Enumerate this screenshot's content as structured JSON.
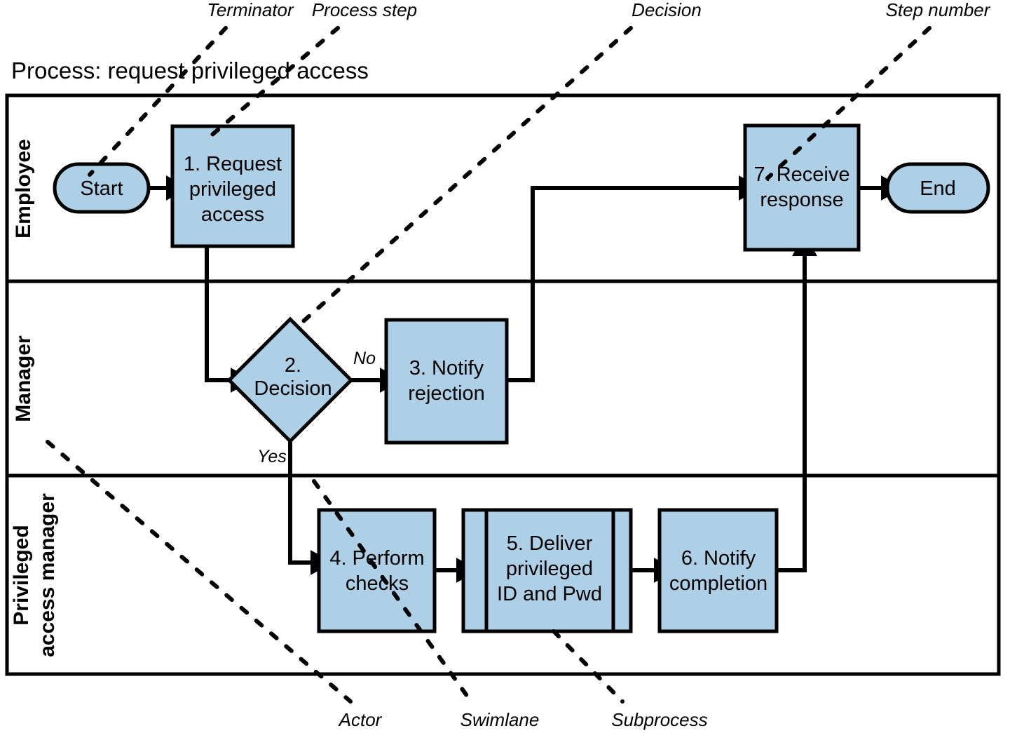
{
  "diagram": {
    "title": "Process: request privileged access",
    "accent_color": "#aed0e6",
    "line_color": "#000000",
    "background": "#ffffff"
  },
  "lanes": [
    {
      "id": "employee",
      "label": "Employee"
    },
    {
      "id": "manager",
      "label": "Manager"
    },
    {
      "id": "privileged-access-manager",
      "label": "Privileged\naccess manager",
      "label_line1": "Privileged",
      "label_line2": "access manager"
    }
  ],
  "nodes": [
    {
      "id": "start",
      "type": "terminator",
      "lane": "employee",
      "label": "Start",
      "lines": [
        "Start"
      ]
    },
    {
      "id": "step1",
      "type": "process",
      "lane": "employee",
      "label": "1. Request privileged access",
      "number": "1",
      "lines": [
        "1. Request",
        "privileged",
        "access"
      ]
    },
    {
      "id": "step7",
      "type": "process",
      "lane": "employee",
      "label": "7. Receive response",
      "number": "7",
      "lines": [
        "7. Receive",
        "response"
      ]
    },
    {
      "id": "end",
      "type": "terminator",
      "lane": "employee",
      "label": "End",
      "lines": [
        "End"
      ]
    },
    {
      "id": "step2",
      "type": "decision",
      "lane": "manager",
      "label": "2. Decision",
      "number": "2",
      "lines": [
        "2.",
        "Decision"
      ]
    },
    {
      "id": "step3",
      "type": "process",
      "lane": "manager",
      "label": "3. Notify rejection",
      "number": "3",
      "lines": [
        "3. Notify",
        "rejection"
      ]
    },
    {
      "id": "step4",
      "type": "process",
      "lane": "privileged-access-manager",
      "label": "4. Perform checks",
      "number": "4",
      "lines": [
        "4. Perform",
        "checks"
      ]
    },
    {
      "id": "step5",
      "type": "subprocess",
      "lane": "privileged-access-manager",
      "label": "5. Deliver privileged ID and Pwd",
      "number": "5",
      "lines": [
        "5. Deliver",
        "privileged",
        "ID and Pwd"
      ]
    },
    {
      "id": "step6",
      "type": "process",
      "lane": "privileged-access-manager",
      "label": "6. Notify completion",
      "number": "6",
      "lines": [
        "6. Notify",
        "completion"
      ]
    }
  ],
  "branch_labels": [
    {
      "id": "no",
      "text": "No",
      "from": "step2",
      "to": "step3"
    },
    {
      "id": "yes",
      "text": "Yes",
      "from": "step2",
      "to": "step4"
    }
  ],
  "callouts": [
    {
      "id": "terminator",
      "text": "Terminator",
      "points_to": "start"
    },
    {
      "id": "process-step",
      "text": "Process step",
      "points_to": "step1"
    },
    {
      "id": "decision",
      "text": "Decision",
      "points_to": "step2"
    },
    {
      "id": "step-number",
      "text": "Step number",
      "points_to": "step7"
    },
    {
      "id": "actor",
      "text": "Actor",
      "points_to": "lane-label"
    },
    {
      "id": "swimlane",
      "text": "Swimlane",
      "points_to": "lane-divider"
    },
    {
      "id": "subprocess",
      "text": "Subprocess",
      "points_to": "step5"
    }
  ],
  "flow": [
    {
      "from": "start",
      "to": "step1"
    },
    {
      "from": "step1",
      "to": "step2"
    },
    {
      "from": "step2",
      "to": "step3",
      "label": "No"
    },
    {
      "from": "step2",
      "to": "step4",
      "label": "Yes"
    },
    {
      "from": "step3",
      "to": "step7"
    },
    {
      "from": "step4",
      "to": "step5"
    },
    {
      "from": "step5",
      "to": "step6"
    },
    {
      "from": "step6",
      "to": "step7"
    },
    {
      "from": "step7",
      "to": "end"
    }
  ]
}
